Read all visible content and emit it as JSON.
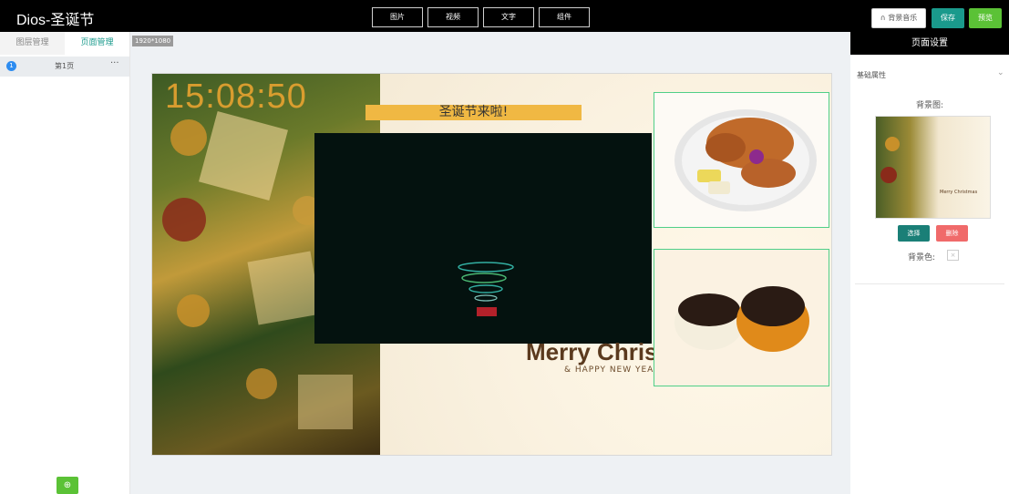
{
  "app": {
    "title": "Dios-圣诞节"
  },
  "toolbar": {
    "image_label": "图片",
    "video_label": "视频",
    "text_label": "文字",
    "component_label": "组件",
    "music_label": "∩ 背景音乐",
    "save_label": "保存",
    "preview_label": "预览"
  },
  "left_panel": {
    "tabs": [
      {
        "label": "图层管理",
        "active": false
      },
      {
        "label": "页面管理",
        "active": true
      }
    ],
    "pages": [
      {
        "number": "1",
        "label": "第1页",
        "more": "···"
      }
    ],
    "add_icon": "⊕"
  },
  "canvas": {
    "resolution": "1920*1080",
    "clock": "15:08:50",
    "banner": "圣诞节来啦!",
    "greeting": "Merry Christmas",
    "subgreeting": "& HAPPY NEW YEAR"
  },
  "right_panel": {
    "title": "页面设置",
    "section": "基础属性",
    "bg_image_label": "背景图:",
    "select_label": "选择",
    "delete_label": "删除",
    "bg_color_label": "背景色:",
    "swatch_mark": "×",
    "thumb_text": "Merry Christmas"
  },
  "colors": {
    "accent": "#1a9a8c",
    "preview_green": "#5bc236",
    "delete_red": "#f06a6a",
    "selection_border": "#4fcf88",
    "banner_yellow": "#f0b843"
  }
}
